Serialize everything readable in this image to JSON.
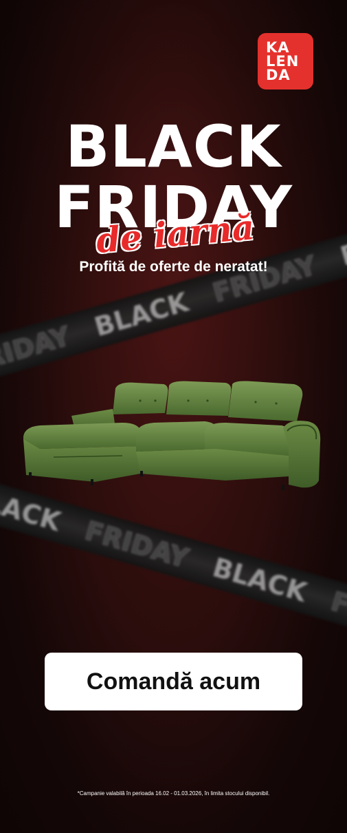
{
  "brand": {
    "logo_lines": [
      "KA",
      "LEN",
      "DA"
    ],
    "logo_color": "#e5312d"
  },
  "headline": {
    "line1": "BLACK",
    "line2": "FRIDAY",
    "script": "de iarnă"
  },
  "subtitle": "Profită de oferte de neratat!",
  "tape": {
    "word1": "BLACK",
    "word2": "FRIDAY"
  },
  "product": {
    "icon": "green-corner-sofa-image",
    "color": "#5a7a3c"
  },
  "cta": {
    "label": "Comandă acum"
  },
  "footnote": "*Campanie valabilă în perioada 16.02 - 01.03.2026, în limita stocului disponibil.",
  "colors": {
    "background": "#2e0e0d",
    "accent": "#e82a2a"
  }
}
